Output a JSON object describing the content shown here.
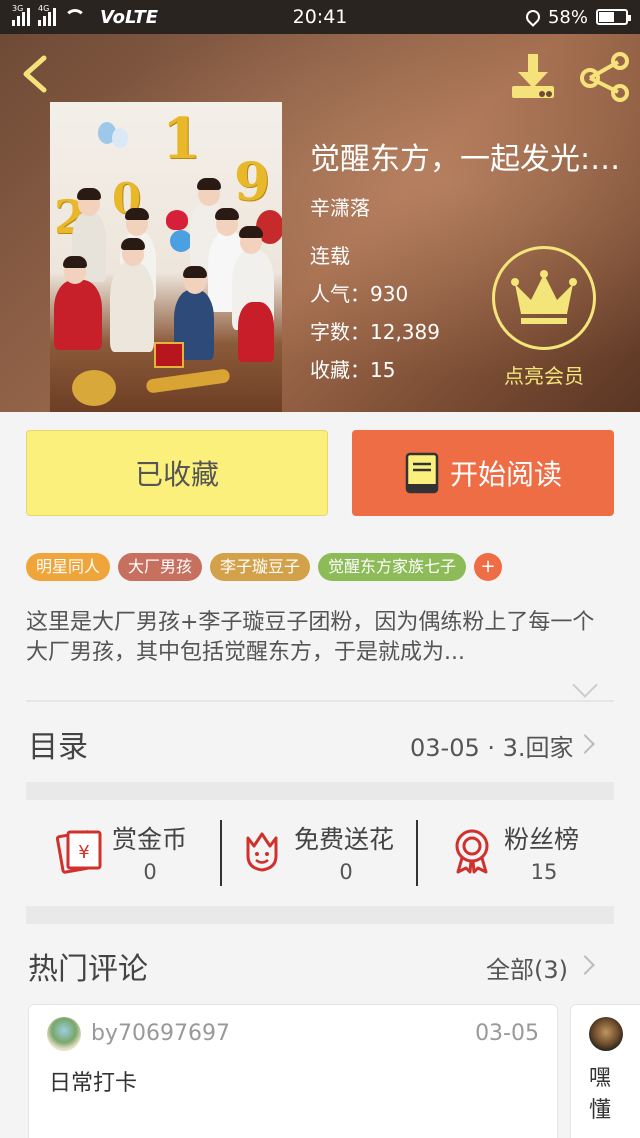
{
  "status_bar": {
    "net1": "3G",
    "net2": "4G",
    "volte": "VoLTE",
    "time": "20:41",
    "battery": "58%",
    "battery_level": 0.58
  },
  "book": {
    "title": "觉醒东方，一起发光:…",
    "author": "辛潇落",
    "status": "连载",
    "popularity": "人气：930",
    "word_count": "字数：12,389",
    "collections": "收藏：15",
    "vip_label": "点亮会员"
  },
  "cover": {
    "year_digits": [
      "2",
      "0",
      "1",
      "9"
    ]
  },
  "actions": {
    "favorited_label": "已收藏",
    "start_reading_label": "开始阅读"
  },
  "tags": [
    {
      "label": "明星同人",
      "color": "#f0a53a"
    },
    {
      "label": "大厂男孩",
      "color": "#c8705f"
    },
    {
      "label": "李子璇豆子",
      "color": "#d2a14a"
    },
    {
      "label": "觉醒东方家族七子",
      "color": "#8cbb58"
    }
  ],
  "tag_add": "+",
  "description": "这里是大厂男孩+李子璇豆子团粉，因为偶练粉上了每一个大厂男孩，其中包括觉醒东方，于是就成为...",
  "toc": {
    "label": "目录",
    "latest": "03-05 · 3.回家"
  },
  "stats": [
    {
      "label": "赏金币",
      "value": "0",
      "icon": "red-envelope-icon"
    },
    {
      "label": "免费送花",
      "value": "0",
      "icon": "flower-icon"
    },
    {
      "label": "粉丝榜",
      "value": "15",
      "icon": "ribbon-medal-icon"
    }
  ],
  "hot_comments": {
    "title": "热门评论",
    "all_label": "全部(3)",
    "items": [
      {
        "user": "by70697697",
        "date": "03-05",
        "text": "日常打卡"
      },
      {
        "text": "嘿懂"
      }
    ]
  },
  "colors": {
    "accent_orange": "#ee6d45",
    "accent_yellow": "#fbf07c",
    "vip_gold": "#f3e57a"
  }
}
